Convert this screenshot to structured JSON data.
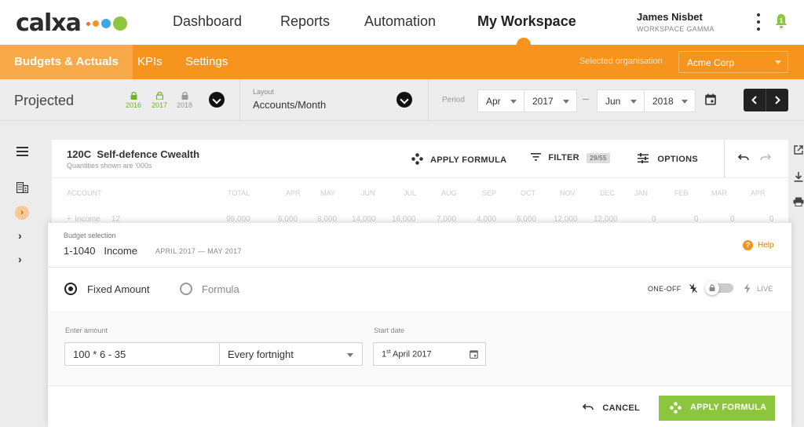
{
  "app": {
    "logo_text": "calxa",
    "logo_dots": [
      "#f26b3a",
      "#f7941d",
      "#3ea8e5",
      "#8cc63f"
    ]
  },
  "topnav": {
    "links": [
      "Dashboard",
      "Reports",
      "Automation",
      "My Workspace"
    ],
    "active": "My Workspace",
    "user_name": "James Nisbet",
    "workspace": "WORKSPACE GAMMA",
    "notification_count": "1"
  },
  "subnav": {
    "tabs": [
      "Budgets & Actuals",
      "KPIs",
      "Settings"
    ],
    "active": "Budgets & Actuals",
    "org_label": "Selected organisation",
    "org_value": "Acme Corp"
  },
  "toolbar": {
    "title": "Projected",
    "years": [
      {
        "label": "2016",
        "color": "#6bb52a",
        "locked": true
      },
      {
        "label": "2017",
        "color": "#6bb52a",
        "locked": false
      },
      {
        "label": "2018",
        "color": "#999999",
        "locked": true
      }
    ],
    "layout_label": "Layout",
    "layout_value": "Accounts/Month",
    "period_label": "Period",
    "from_month": "Apr",
    "from_year": "2017",
    "to_month": "Jun",
    "to_year": "2018"
  },
  "card": {
    "code": "120C",
    "title": "Self-defence Cwealth",
    "subtitle": "Quantities shown are '000s",
    "apply_formula": "APPLY FORMULA",
    "filter": "FILTER",
    "filter_count": "29/55",
    "options": "OPTIONS",
    "columns": [
      "ACCOUNT",
      "TOTAL",
      "APR",
      "MAY",
      "JUN",
      "JUL",
      "AUG",
      "SEP",
      "OCT",
      "NOV",
      "DEC",
      "JAN",
      "FEB",
      "MAR",
      "APR"
    ],
    "row": {
      "name": "Income",
      "badge": "12",
      "values": [
        "99,000",
        "6,000",
        "8,000",
        "14,000",
        "16,000",
        "7,000",
        "4,000",
        "6,000",
        "12,000",
        "12,000",
        "0",
        "0",
        "0",
        "0"
      ]
    }
  },
  "dialog": {
    "selection_label": "Budget selection",
    "account_code": "1-1040",
    "account_name": "Income",
    "date_range": "APRIL 2017 — MAY 2017",
    "help": "Help",
    "mode_fixed": "Fixed Amount",
    "mode_formula": "Formula",
    "selected_mode": "Fixed Amount",
    "one_off": "ONE-OFF",
    "live": "LIVE",
    "amount_label": "Enter amount",
    "amount_value": "100 * 6 - 35",
    "frequency": "Every fortnight",
    "start_label": "Start date",
    "start_day": "1",
    "start_suffix": "st",
    "start_rest": " April 2017",
    "cancel": "CANCEL",
    "apply": "APPLY FORMULA"
  }
}
